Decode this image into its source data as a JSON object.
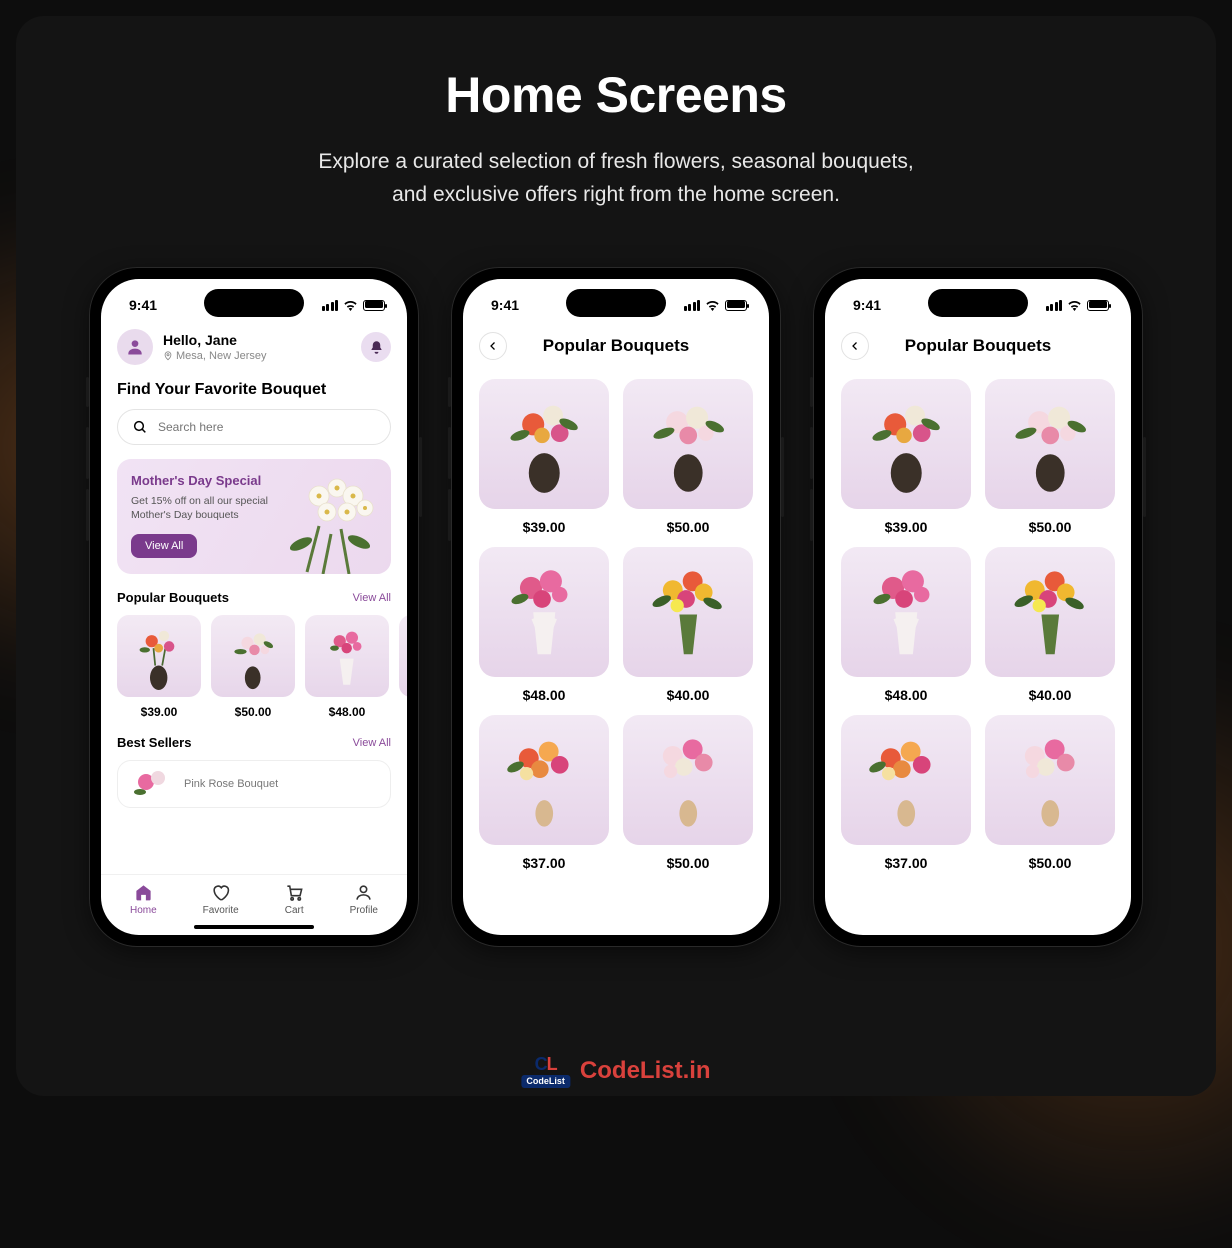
{
  "page": {
    "title": "Home Screens",
    "subtitle_line1": "Explore a curated selection of fresh flowers, seasonal bouquets,",
    "subtitle_line2": "and exclusive offers right from the home screen."
  },
  "status": {
    "time": "9:41"
  },
  "home": {
    "greeting": "Hello, Jane",
    "location": "Mesa, New Jersey",
    "heading": "Find Your Favorite Bouquet",
    "search_placeholder": "Search here",
    "banner": {
      "title": "Mother's Day Special",
      "subtitle": "Get 15% off on all our special Mother's Day bouquets",
      "cta": "View All"
    },
    "popular": {
      "title": "Popular Bouquets",
      "link": "View All",
      "items": [
        {
          "price": "$39.00"
        },
        {
          "price": "$50.00"
        },
        {
          "price": "$48.00"
        }
      ]
    },
    "best": {
      "title": "Best Sellers",
      "link": "View All",
      "item_name": "Pink Rose Bouquet"
    },
    "tabs": [
      {
        "label": "Home"
      },
      {
        "label": "Favorite"
      },
      {
        "label": "Cart"
      },
      {
        "label": "Profile"
      }
    ]
  },
  "popular": {
    "title": "Popular Bouquets",
    "items": [
      {
        "price": "$39.00"
      },
      {
        "price": "$50.00"
      },
      {
        "price": "$48.00"
      },
      {
        "price": "$40.00"
      },
      {
        "price": "$37.00"
      },
      {
        "price": "$50.00"
      }
    ]
  },
  "watermark": {
    "text": "CodeList.in",
    "badge": "CodeList"
  },
  "colors": {
    "accent": "#8a4a9a"
  }
}
